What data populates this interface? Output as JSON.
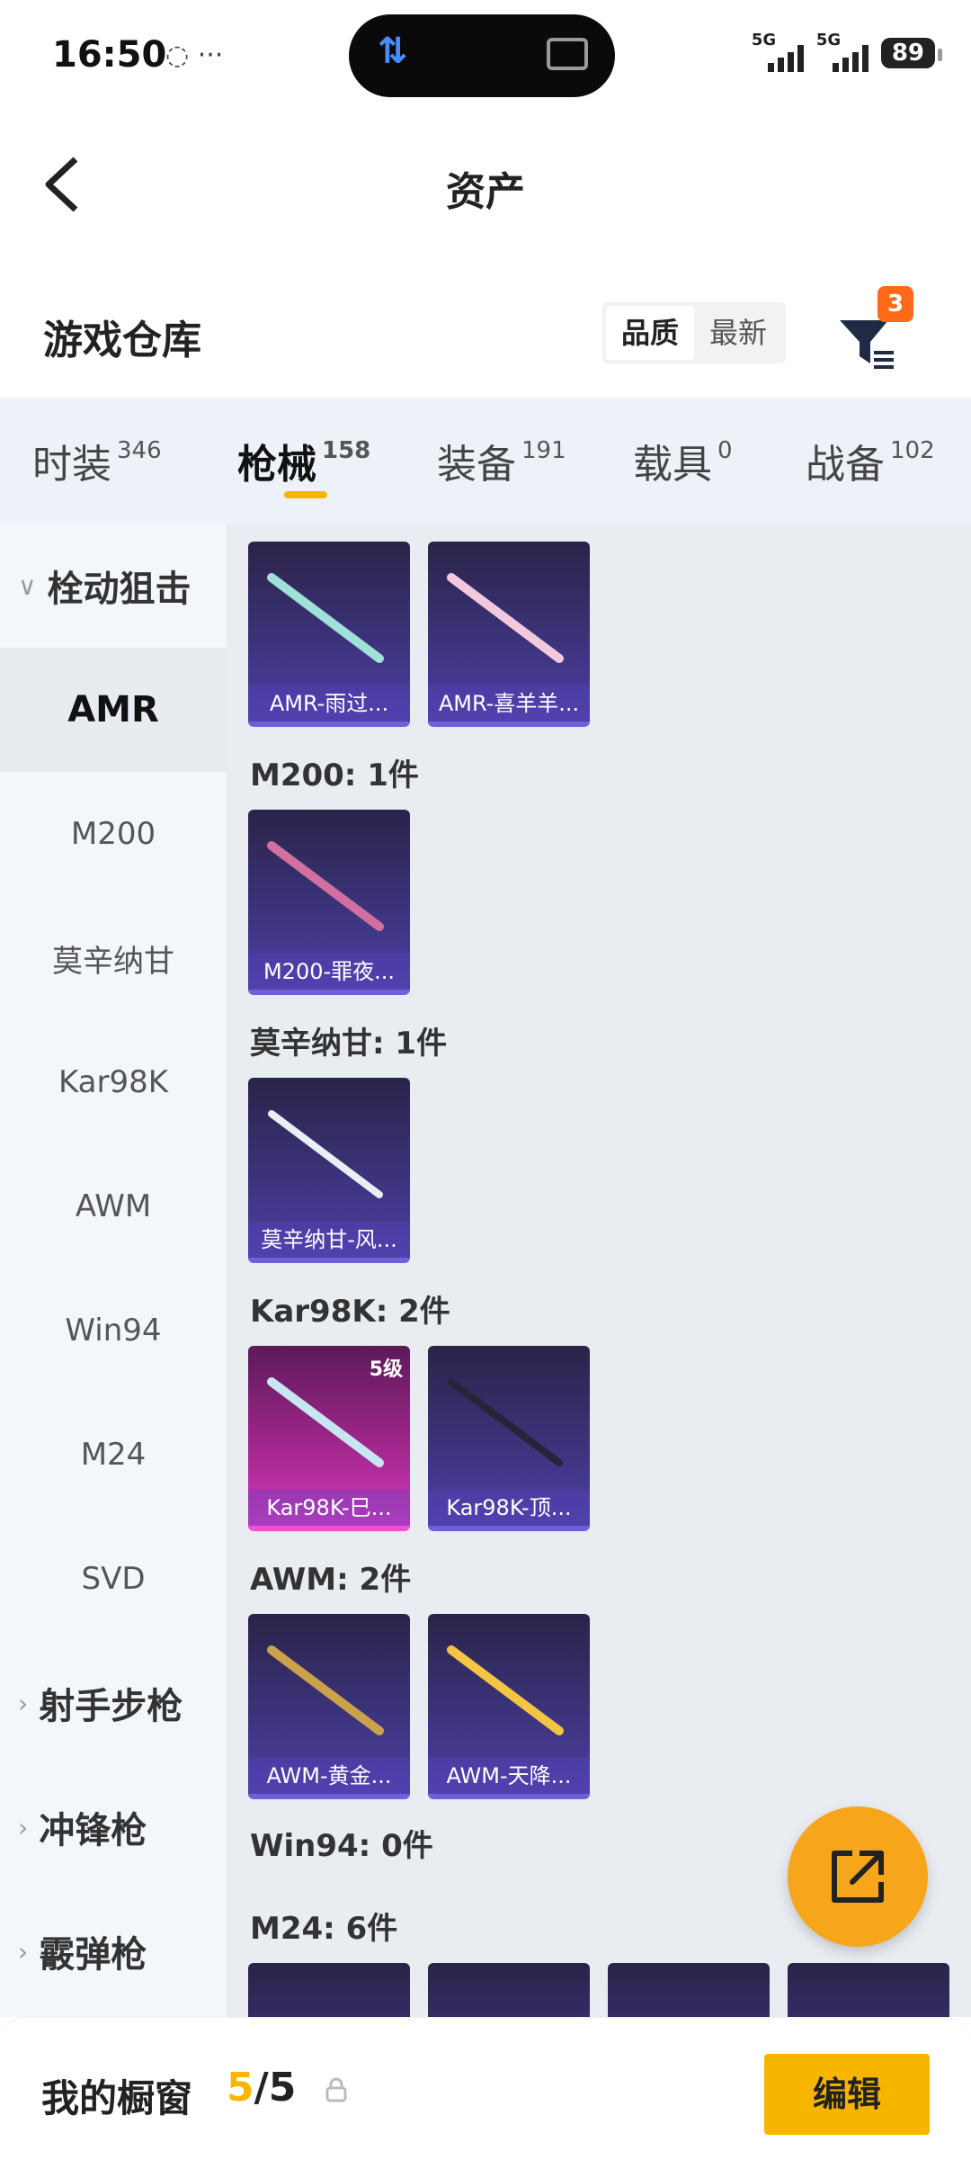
{
  "status_bar": {
    "time": "16:50",
    "left_icons": "◌ ···",
    "network1": "5G",
    "network2": "5G",
    "battery": "89"
  },
  "nav": {
    "title": "资产"
  },
  "header": {
    "title": "游戏仓库",
    "sort_options": [
      "品质",
      "最新"
    ],
    "filter_badge": "3"
  },
  "tabs": [
    {
      "label": "时装",
      "count": "346"
    },
    {
      "label": "枪械",
      "count": "158"
    },
    {
      "label": "装备",
      "count": "191"
    },
    {
      "label": "载具",
      "count": "0"
    },
    {
      "label": "战备",
      "count": "102"
    }
  ],
  "sidebar": {
    "groups": [
      {
        "label": "栓动狙击"
      },
      {
        "label": "射手步枪"
      },
      {
        "label": "冲锋枪"
      },
      {
        "label": "霰弹枪"
      }
    ],
    "items": [
      "AMR",
      "M200",
      "莫辛纳甘",
      "Kar98K",
      "AWM",
      "Win94",
      "M24",
      "SVD"
    ]
  },
  "content": {
    "groups": [
      {
        "label": "M200: 1件"
      },
      {
        "label": "莫辛纳甘: 1件"
      },
      {
        "label": "Kar98K: 2件"
      },
      {
        "label": "AWM: 2件"
      },
      {
        "label": "Win94: 0件"
      },
      {
        "label": "M24: 6件"
      }
    ],
    "cards": [
      {
        "name": "AMR-雨过...",
        "color": "#9fe0d8"
      },
      {
        "name": "AMR-喜羊羊...",
        "color": "#f3c9dd"
      },
      {
        "name": "M200-罪夜...",
        "color": "#d070a0"
      },
      {
        "name": "莫辛纳甘-风...",
        "color": "#e8f0f4"
      },
      {
        "name": "Kar98K-巳...",
        "color": "#c8e6f2",
        "level": "5级"
      },
      {
        "name": "Kar98K-顶...",
        "color": "#2a2238"
      },
      {
        "name": "AWM-黄金...",
        "color": "#c9a24a"
      },
      {
        "name": "AWM-天降...",
        "color": "#f2c542"
      }
    ]
  },
  "bottom_bar": {
    "title": "我的橱窗",
    "count_current": "5",
    "count_total": "/5",
    "edit_label": "编辑"
  }
}
